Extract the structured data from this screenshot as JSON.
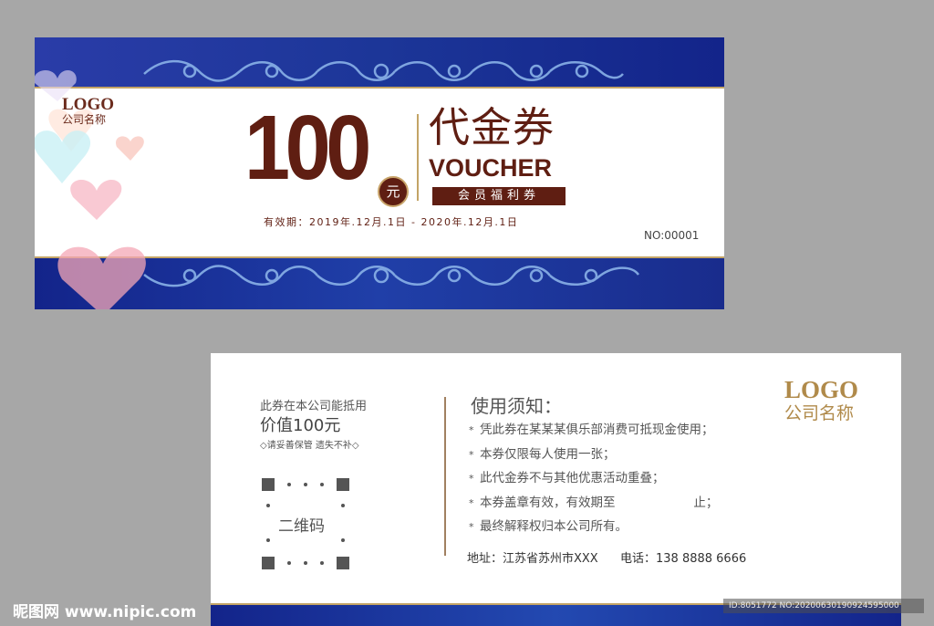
{
  "front": {
    "logo": "LOGO",
    "company": "公司名称",
    "amount": "100",
    "unit": "元",
    "title_cn": "代金券",
    "title_en": "VOUCHER",
    "tag": "会员福利券",
    "validity": "有效期：2019年.12月.1日 - 2020年.12月.1日",
    "serial": "NO:00001"
  },
  "back": {
    "line1": "此券在本公司能抵用",
    "line2": "价值100元",
    "note": "◇请妥善保管 遗失不补◇",
    "qr_label": "二维码",
    "usage_title": "使用须知：",
    "usage_items": [
      "凭此券在某某某俱乐部消费可抵现金使用；",
      "本券仅限每人使用一张；",
      "此代金券不与其他优惠活动重叠；",
      "本券盖章有效，有效期至                    止；",
      "最终解释权归本公司所有。"
    ],
    "address": "地址：江苏省苏州市XXX",
    "phone": "电话：138 8888 6666",
    "logo": "LOGO",
    "company": "公司名称"
  },
  "watermark": {
    "left": "昵图网 www.nipic.com",
    "right": "ID:8051772 NO:20200630190924595000"
  },
  "colors": {
    "brown": "#5f1e12",
    "navy": "#1a2f86",
    "gold": "#c3a466",
    "background": "#a7a7a7"
  }
}
